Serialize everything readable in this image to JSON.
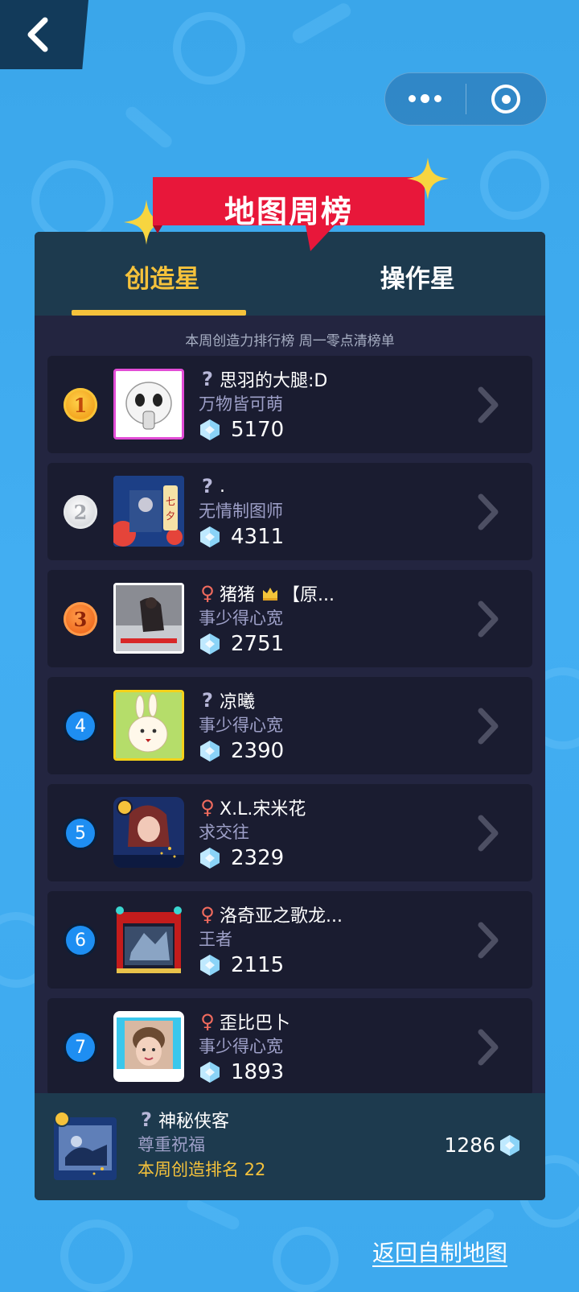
{
  "header": {
    "back_icon": "chevron-left-icon",
    "capsule_more_icon": "more-dots-icon",
    "capsule_close_icon": "target-circle-icon"
  },
  "banner": {
    "title": "地图周榜"
  },
  "tabs": [
    {
      "label": "创造星",
      "active": true
    },
    {
      "label": "操作星",
      "active": false
    }
  ],
  "subtitle": "本周创造力排行榜 周一零点清榜单",
  "ranking": [
    {
      "rank": "1",
      "gender": "?",
      "name": "思羽的大腿:D",
      "motto": "万物皆可萌",
      "score": "5170"
    },
    {
      "rank": "2",
      "gender": "?",
      "name": ".",
      "motto": "无情制图师",
      "score": "4311"
    },
    {
      "rank": "3",
      "gender": "♀",
      "name": "猪猪",
      "name_suffix": "【原...",
      "motto": "事少得心宽",
      "score": "2751"
    },
    {
      "rank": "4",
      "gender": "?",
      "name": "凉曦",
      "motto": "事少得心宽",
      "score": "2390"
    },
    {
      "rank": "5",
      "gender": "♀",
      "name": "X.L.宋米花",
      "motto": "求交往",
      "score": "2329"
    },
    {
      "rank": "6",
      "gender": "♀",
      "name": "洛奇亚之歌龙...",
      "motto": "王者",
      "score": "2115"
    },
    {
      "rank": "7",
      "gender": "♀",
      "name": "歪比巴卜",
      "motto": "事少得心宽",
      "score": "1893"
    }
  ],
  "me": {
    "gender": "?",
    "name": "神秘侠客",
    "motto": "尊重祝福",
    "rank_text": "本周创造排名 22",
    "score": "1286"
  },
  "footer": {
    "return_label": "返回自制地图"
  },
  "colors": {
    "accent": "#f5c23b",
    "banner_red": "#e8173a",
    "panel": "#232540",
    "row": "#1a1c30",
    "tab_bg": "#1d3a4e"
  }
}
